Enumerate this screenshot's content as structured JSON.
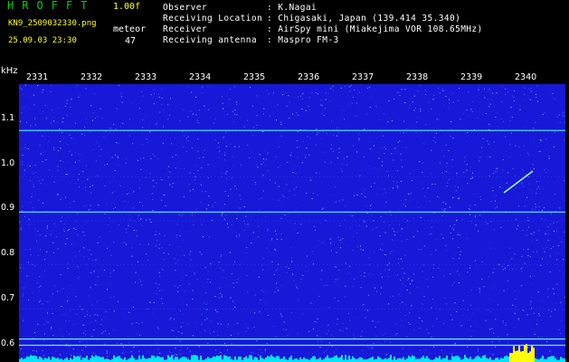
{
  "header": {
    "app_title": "HROFFT",
    "version": "1.00f",
    "file_name": "KN9_2509032330.png",
    "meteor_label": "meteor",
    "datetime": "25.09.03 23:30",
    "meteor_count": "47"
  },
  "info": [
    {
      "label": "Observer",
      "value": "K.Nagai"
    },
    {
      "label": "Receiving Location",
      "value": "Chigasaki, Japan (139.414 35.340)"
    },
    {
      "label": "Receiver",
      "value": "AirSpy mini (Miakejima VOR 108.65MHz)"
    },
    {
      "label": "Receiving antenna",
      "value": "Maspro FM-3"
    }
  ],
  "chart_data": {
    "type": "heatmap",
    "y_unit": "kHz",
    "y_ticks": [
      "1.1",
      "1.0",
      "0.9",
      "0.8",
      "0.7",
      "0.6"
    ],
    "x_ticks": [
      "2331",
      "2332",
      "2333",
      "2334",
      "2335",
      "2336",
      "2337",
      "2338",
      "2339",
      "2340"
    ],
    "ylim": [
      0.58,
      1.21
    ],
    "background_color": "#1a1ae0",
    "carrier_lines_khz": [
      1.105,
      0.92,
      0.632,
      0.618
    ],
    "meteor_echo_color": "#80ffff",
    "bottom_histogram_color": "#00e5ff",
    "histogram_peak_color": "#ffff00"
  }
}
